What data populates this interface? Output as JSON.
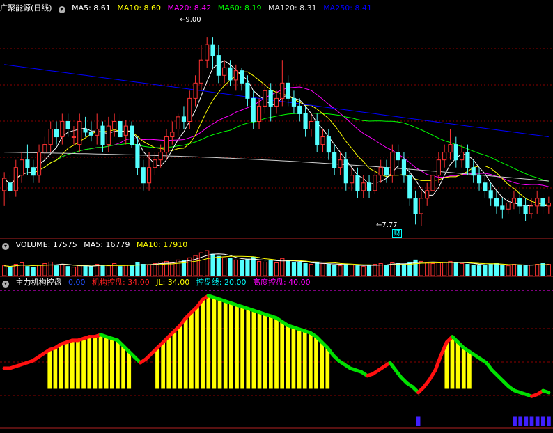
{
  "header": {
    "stock_name": "广聚能源(日线)",
    "ma": [
      {
        "label": "MA5: 8.61",
        "color": "#ffffff"
      },
      {
        "label": "MA10: 8.60",
        "color": "#ffff00"
      },
      {
        "label": "MA20: 8.42",
        "color": "#ff00ff"
      },
      {
        "label": "MA60: 8.19",
        "color": "#00ff00"
      },
      {
        "label": "MA120: 8.31",
        "color": "#e0e0e0"
      },
      {
        "label": "MA250: 8.41",
        "color": "#0000ff"
      }
    ]
  },
  "volume_header": {
    "items": [
      {
        "label": "VOLUME: 17575",
        "color": "#ffffff"
      },
      {
        "label": "MA5: 16779",
        "color": "#ffffff"
      },
      {
        "label": "MA10: 17910",
        "color": "#ffff00"
      }
    ]
  },
  "indicator_header": {
    "name": "主力机构控盘",
    "items": [
      {
        "label": "0.00",
        "color": "#2050ff"
      },
      {
        "label": "机构控盘: 34.00",
        "color": "#ff2020"
      },
      {
        "label": "JL: 34.00",
        "color": "#ffff00"
      },
      {
        "label": "控盘线: 20.00",
        "color": "#00ffff"
      },
      {
        "label": "高度控盘: 40.00",
        "color": "#ff00ff"
      }
    ]
  },
  "annotations": {
    "high": "9.00",
    "low": "7.77",
    "badge": "财"
  },
  "colors": {
    "up": "#ff3232",
    "down": "#54ffff",
    "grid": "#8b0000",
    "ma5": "#ffffff",
    "ma10": "#ffff00",
    "ma20": "#ff00ff",
    "ma60": "#00ff00",
    "ma120": "#d0d0d0",
    "ma250": "#0000ff"
  },
  "chart_data": [
    {
      "type": "candlestick",
      "title": "广聚能源(日线)",
      "ylim": [
        7.7,
        9.15
      ],
      "candles": [
        [
          8.0,
          8.08,
          7.9,
          8.12
        ],
        [
          8.05,
          8.0,
          7.95,
          8.1
        ],
        [
          8.0,
          8.15,
          7.96,
          8.2
        ],
        [
          8.1,
          8.2,
          8.05,
          8.25
        ],
        [
          8.2,
          8.15,
          8.1,
          8.3
        ],
        [
          8.15,
          8.1,
          8.05,
          8.2
        ],
        [
          8.1,
          8.25,
          8.05,
          8.3
        ],
        [
          8.25,
          8.3,
          8.2,
          8.35
        ],
        [
          8.3,
          8.4,
          8.25,
          8.45
        ],
        [
          8.4,
          8.35,
          8.3,
          8.45
        ],
        [
          8.35,
          8.45,
          8.3,
          8.5
        ],
        [
          8.45,
          8.4,
          8.35,
          8.5
        ],
        [
          8.35,
          8.35,
          8.3,
          8.42
        ],
        [
          8.3,
          8.45,
          8.25,
          8.5
        ],
        [
          8.4,
          8.38,
          8.35,
          8.48
        ],
        [
          8.38,
          8.36,
          8.32,
          8.45
        ],
        [
          8.36,
          8.4,
          8.3,
          8.5
        ],
        [
          8.42,
          8.3,
          8.25,
          8.45
        ],
        [
          8.3,
          8.42,
          8.25,
          8.48
        ],
        [
          8.4,
          8.45,
          8.35,
          8.5
        ],
        [
          8.45,
          8.35,
          8.3,
          8.5
        ],
        [
          8.36,
          8.42,
          8.3,
          8.46
        ],
        [
          8.42,
          8.3,
          8.28,
          8.45
        ],
        [
          8.3,
          8.15,
          8.1,
          8.35
        ],
        [
          8.15,
          8.05,
          8.0,
          8.2
        ],
        [
          8.05,
          8.15,
          8.0,
          8.25
        ],
        [
          8.15,
          8.2,
          8.1,
          8.25
        ],
        [
          8.2,
          8.25,
          8.15,
          8.3
        ],
        [
          8.25,
          8.35,
          8.2,
          8.4
        ],
        [
          8.35,
          8.38,
          8.3,
          8.45
        ],
        [
          8.4,
          8.48,
          8.35,
          8.5
        ],
        [
          8.48,
          8.45,
          8.4,
          8.55
        ],
        [
          8.45,
          8.6,
          8.4,
          8.65
        ],
        [
          8.6,
          8.7,
          8.55,
          8.75
        ],
        [
          8.7,
          8.85,
          8.65,
          8.95
        ],
        [
          8.85,
          8.95,
          8.8,
          9.0
        ],
        [
          8.95,
          8.88,
          8.8,
          9.0
        ],
        [
          8.88,
          8.75,
          8.7,
          8.95
        ],
        [
          8.75,
          8.8,
          8.7,
          8.85
        ],
        [
          8.8,
          8.72,
          8.68,
          8.85
        ],
        [
          8.72,
          8.78,
          8.65,
          8.82
        ],
        [
          8.78,
          8.7,
          8.65,
          8.8
        ],
        [
          8.7,
          8.6,
          8.55,
          8.75
        ],
        [
          8.6,
          8.45,
          8.4,
          8.65
        ],
        [
          8.45,
          8.55,
          8.4,
          8.6
        ],
        [
          8.55,
          8.65,
          8.5,
          8.7
        ],
        [
          8.65,
          8.55,
          8.45,
          8.7
        ],
        [
          8.55,
          8.6,
          8.5,
          8.65
        ],
        [
          8.6,
          8.7,
          8.55,
          8.85
        ],
        [
          8.7,
          8.6,
          8.55,
          8.75
        ],
        [
          8.6,
          8.55,
          8.5,
          8.65
        ],
        [
          8.55,
          8.5,
          8.45,
          8.6
        ],
        [
          8.5,
          8.4,
          8.35,
          8.55
        ],
        [
          8.4,
          8.45,
          8.35,
          8.5
        ],
        [
          8.45,
          8.3,
          8.25,
          8.5
        ],
        [
          8.3,
          8.35,
          8.25,
          8.4
        ],
        [
          8.35,
          8.25,
          8.2,
          8.4
        ],
        [
          8.25,
          8.15,
          8.1,
          8.3
        ],
        [
          8.15,
          8.2,
          8.1,
          8.25
        ],
        [
          8.2,
          8.05,
          8.0,
          8.25
        ],
        [
          8.05,
          8.1,
          8.0,
          8.15
        ],
        [
          8.1,
          8.0,
          7.95,
          8.15
        ],
        [
          8.0,
          8.05,
          7.95,
          8.1
        ],
        [
          8.05,
          8.0,
          7.95,
          8.1
        ],
        [
          8.0,
          8.1,
          7.98,
          8.15
        ],
        [
          8.1,
          8.15,
          8.05,
          8.2
        ],
        [
          8.15,
          8.1,
          8.05,
          8.2
        ],
        [
          8.1,
          8.25,
          8.05,
          8.3
        ],
        [
          8.25,
          8.2,
          8.15,
          8.3
        ],
        [
          8.2,
          8.1,
          8.05,
          8.25
        ],
        [
          8.1,
          7.95,
          7.9,
          8.15
        ],
        [
          7.95,
          7.85,
          7.78,
          8.0
        ],
        [
          7.85,
          7.95,
          7.77,
          8.0
        ],
        [
          7.95,
          8.0,
          7.9,
          8.05
        ],
        [
          8.0,
          8.1,
          7.95,
          8.15
        ],
        [
          8.1,
          8.2,
          8.05,
          8.25
        ],
        [
          8.2,
          8.25,
          8.15,
          8.3
        ],
        [
          8.25,
          8.3,
          8.2,
          8.4
        ],
        [
          8.3,
          8.2,
          8.15,
          8.35
        ],
        [
          8.2,
          8.25,
          8.15,
          8.3
        ],
        [
          8.25,
          8.15,
          8.1,
          8.3
        ],
        [
          8.15,
          8.1,
          8.05,
          8.2
        ],
        [
          8.1,
          8.05,
          8.0,
          8.15
        ],
        [
          8.05,
          8.0,
          7.95,
          8.1
        ],
        [
          8.0,
          7.95,
          7.9,
          8.05
        ],
        [
          7.95,
          7.9,
          7.85,
          8.0
        ],
        [
          7.9,
          7.88,
          7.82,
          7.95
        ],
        [
          7.88,
          7.92,
          7.85,
          7.95
        ],
        [
          7.92,
          7.95,
          7.88,
          8.0
        ],
        [
          7.95,
          7.9,
          7.85,
          8.0
        ],
        [
          7.9,
          7.85,
          7.8,
          7.95
        ],
        [
          7.85,
          7.9,
          7.82,
          7.95
        ],
        [
          7.9,
          7.95,
          7.85,
          8.0
        ],
        [
          7.95,
          7.9,
          7.85,
          7.98
        ],
        [
          7.9,
          7.92,
          7.85,
          7.96
        ]
      ],
      "volume": [
        14,
        12,
        16,
        18,
        13,
        12,
        15,
        17,
        19,
        14,
        16,
        13,
        12,
        15,
        14,
        13,
        16,
        15,
        14,
        17,
        13,
        15,
        14,
        18,
        16,
        15,
        17,
        19,
        20,
        18,
        22,
        21,
        25,
        28,
        32,
        35,
        30,
        27,
        25,
        24,
        22,
        21,
        23,
        26,
        20,
        19,
        22,
        18,
        24,
        21,
        19,
        18,
        17,
        16,
        18,
        17,
        16,
        15,
        14,
        16,
        15,
        14,
        13,
        15,
        16,
        17,
        15,
        18,
        17,
        16,
        19,
        22,
        20,
        18,
        17,
        18,
        19,
        20,
        18,
        17,
        16,
        15,
        14,
        15,
        16,
        17,
        15,
        14,
        16,
        15,
        14,
        15,
        16,
        17,
        16
      ]
    },
    {
      "type": "bar",
      "title": "主力机构控盘",
      "series": [
        {
          "name": "机构控盘",
          "values": [
            11,
            11,
            12,
            13,
            14,
            15,
            17,
            19,
            21,
            22,
            24,
            25,
            26,
            26,
            27,
            28,
            28,
            29,
            28,
            27,
            26,
            23,
            20,
            17,
            14,
            16,
            19,
            22,
            25,
            28,
            31,
            34,
            38,
            41,
            44,
            48,
            50,
            49,
            48,
            47,
            46,
            45,
            44,
            43,
            42,
            41,
            40,
            39,
            38,
            36,
            34,
            33,
            32,
            31,
            30,
            28,
            25,
            22,
            18,
            15,
            13,
            11,
            10,
            9,
            7,
            8,
            10,
            12,
            14,
            10,
            6,
            3,
            1,
            -2,
            1,
            5,
            10,
            18,
            25,
            28,
            25,
            22,
            20,
            18,
            16,
            14,
            10,
            7,
            4,
            1,
            -1,
            -2,
            -3,
            -4,
            -3,
            -1,
            -2
          ]
        },
        {
          "name": "高度控盘",
          "values": [
            40,
            40,
            40,
            40,
            40,
            40,
            40,
            40,
            40,
            40,
            40,
            40,
            40,
            40,
            40,
            40,
            40,
            40,
            40,
            40,
            40,
            40,
            40,
            40,
            40,
            40,
            40,
            40,
            40,
            40,
            40,
            40,
            40,
            40,
            40,
            40,
            40,
            40,
            40,
            40,
            40,
            40,
            40,
            40,
            40,
            40,
            40,
            40,
            40,
            40,
            40,
            40,
            40,
            40,
            40,
            40,
            40,
            40,
            40,
            40,
            40,
            40,
            40,
            40,
            40,
            40,
            40,
            40,
            40,
            40,
            40,
            40,
            40,
            40,
            40,
            40,
            40,
            40,
            40,
            40,
            40,
            40,
            40,
            40,
            40,
            40,
            40,
            40,
            40,
            40,
            40,
            40,
            40,
            40,
            40,
            40,
            40
          ]
        },
        {
          "name": "控盘线",
          "values": [
            20,
            20,
            20,
            20,
            20,
            20,
            20,
            20,
            20,
            20,
            20,
            20,
            20,
            20,
            20,
            20,
            20,
            20,
            20,
            20,
            20,
            20,
            20,
            20,
            20,
            20,
            20,
            20,
            20,
            20,
            20,
            20,
            20,
            20,
            20,
            20,
            20,
            20,
            20,
            20,
            20,
            20,
            20,
            20,
            20,
            20,
            20,
            20,
            20,
            20,
            20,
            20,
            20,
            20,
            20,
            20,
            20,
            20,
            20,
            20,
            20,
            20,
            20,
            20,
            20,
            20,
            20,
            20,
            20,
            20,
            20,
            20,
            20,
            20,
            20,
            20,
            20,
            20,
            20,
            20,
            20,
            20,
            20,
            20,
            20,
            20,
            20,
            20,
            20,
            20,
            20,
            20,
            20,
            20,
            20,
            20,
            20
          ]
        }
      ]
    }
  ]
}
